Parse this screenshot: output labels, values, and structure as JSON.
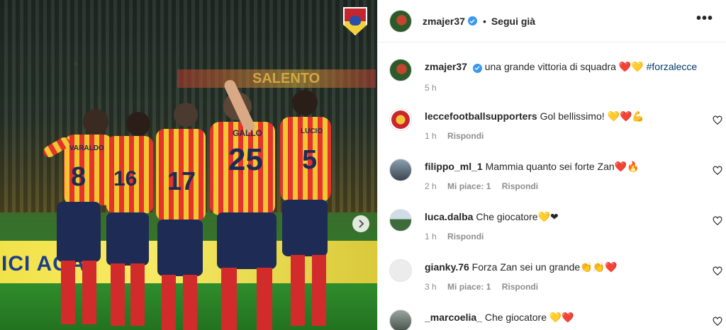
{
  "photo": {
    "banner_text": "ICI AGA",
    "ad_text": "SALENTO",
    "shirt_names": [
      "VARALDO",
      "GALLO",
      "LUCIO"
    ],
    "shirt_numbers": [
      "8",
      "16",
      "17",
      "25",
      "5"
    ]
  },
  "header": {
    "username": "zmajer37",
    "separator": "•",
    "follow_label": "Segui già",
    "more_label": "•••"
  },
  "caption": {
    "username": "zmajer37",
    "text": "una grande vittoria di squadra ❤️💛",
    "hashtag": "#forzalecce",
    "time": "5 h"
  },
  "comments": [
    {
      "username": "leccefootballsupporters",
      "text": "Gol bellissimo! 💛❤️💪",
      "time": "1 h",
      "likes": "",
      "reply": "Rispondi"
    },
    {
      "username": "filippo_ml_1",
      "text": "Mammia quanto sei forte Zan❤️🔥",
      "time": "2 h",
      "likes": "Mi piace: 1",
      "reply": "Rispondi"
    },
    {
      "username": "luca.dalba",
      "text": "Che giocatore💛❤",
      "time": "1 h",
      "likes": "",
      "reply": "Rispondi"
    },
    {
      "username": "gianky.76",
      "text": "Forza Zan sei un grande👏👏❤️",
      "time": "3 h",
      "likes": "Mi piace: 1",
      "reply": "Rispondi"
    },
    {
      "username": "_marcoelia_",
      "text": "Che giocatore 💛❤️",
      "time": "",
      "likes": "",
      "reply": ""
    }
  ],
  "colors": {
    "link": "#00376b",
    "muted": "#8e8e8e",
    "verified": "#3897f0",
    "lecce_red": "#c5262e",
    "lecce_yellow": "#f1d23a"
  },
  "icons": [
    "verified-badge-icon",
    "more-options-icon",
    "heart-icon",
    "next-arrow-icon",
    "team-crest-icon"
  ]
}
